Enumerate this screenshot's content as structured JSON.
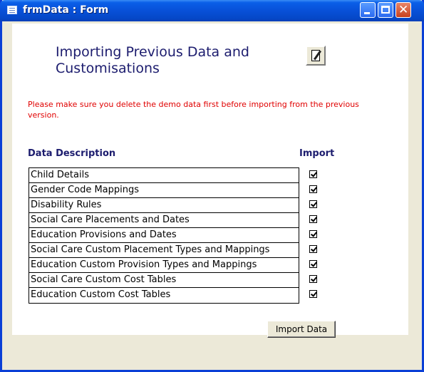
{
  "window": {
    "title": "frmData : Form"
  },
  "form": {
    "heading": "Importing Previous Data and Customisations",
    "warning": "Please make sure you delete the demo data first before importing from the previous version.",
    "columns": {
      "description": "Data Description",
      "import": "Import"
    },
    "rows": [
      {
        "label": "Child Details",
        "checked": true
      },
      {
        "label": "Gender Code Mappings",
        "checked": true
      },
      {
        "label": "Disability Rules",
        "checked": true
      },
      {
        "label": "Social Care Placements and Dates",
        "checked": true
      },
      {
        "label": "Education Provisions and Dates",
        "checked": true
      },
      {
        "label": "Social Care Custom Placement Types and Mappings",
        "checked": true
      },
      {
        "label": "Education Custom Provision Types and Mappings",
        "checked": true
      },
      {
        "label": "Social Care Custom Cost Tables",
        "checked": true
      },
      {
        "label": "Education Custom Cost Tables",
        "checked": true
      }
    ],
    "import_button": "Import Data"
  },
  "colors": {
    "title_bar": "#0850d8",
    "heading": "#1c1c6e",
    "warning": "#e00000",
    "background": "#fff9c8"
  }
}
